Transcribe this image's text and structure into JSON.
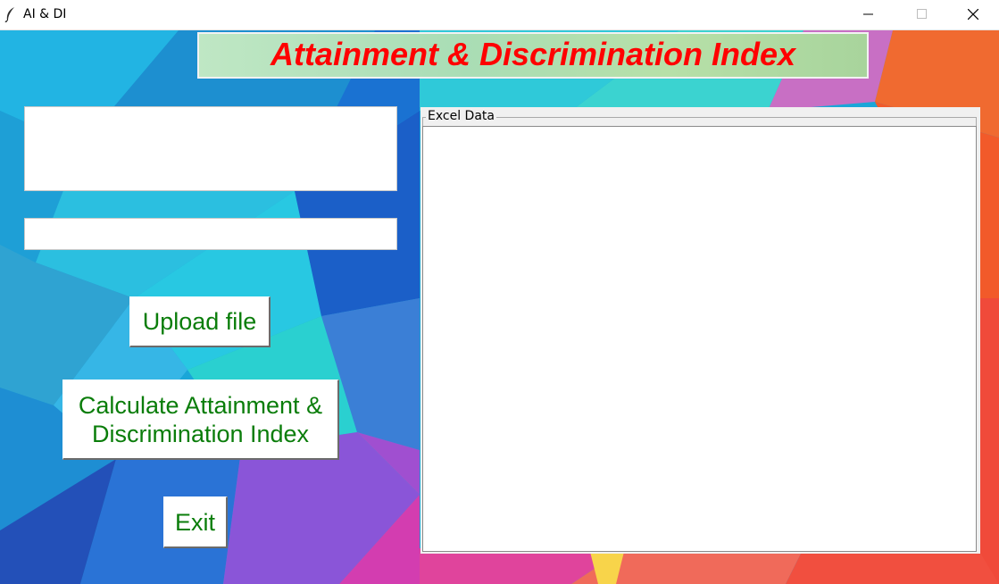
{
  "window": {
    "title": "AI & DI",
    "icon": "feather-icon",
    "controls": [
      "minimize-icon",
      "maximize-icon",
      "close-icon"
    ]
  },
  "banner": {
    "title": "Attainment & Discrimination Index",
    "text_color": "#ff0000"
  },
  "inputs": {
    "file_info_value": "",
    "path_value": ""
  },
  "buttons": {
    "upload_label": "Upload file",
    "calculate_label": "Calculate Attainment & Discrimination Index",
    "exit_label": "Exit",
    "text_color": "#0a7d0a"
  },
  "excel_frame": {
    "label": "Excel Data"
  }
}
